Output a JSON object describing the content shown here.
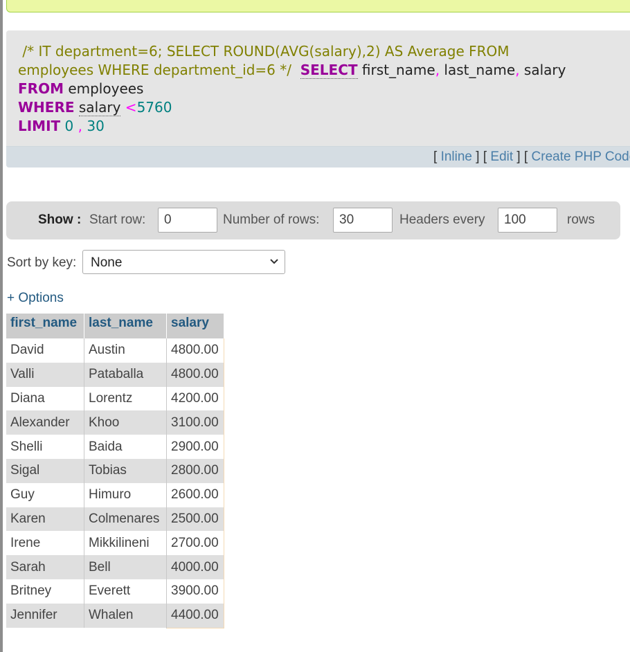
{
  "sql_query": {
    "comment": "/* IT department=6; SELECT ROUND(AVG(salary),2) AS Average FROM",
    "comment_line2": "employees WHERE department_id=6 */",
    "select_kw": "SELECT",
    "col1": "first_name",
    "col2": "last_name",
    "col3": "salary",
    "comma": ",",
    "from_kw": "FROM",
    "table": "employees",
    "where_kw": "WHERE",
    "where_col": "salary",
    "where_op": "<",
    "where_val": "5760",
    "limit_kw": "LIMIT",
    "limit_offset": "0",
    "limit_count": "30"
  },
  "sql_links": {
    "open": "[",
    "close": "]",
    "inline": "Inline",
    "edit": "Edit",
    "create_php": "Create PHP Code"
  },
  "navigation": {
    "show_label": "Show :",
    "start_row_label": "Start row:",
    "start_row_value": "0",
    "num_rows_label": "Number of rows:",
    "num_rows_value": "30",
    "headers_every_label": "Headers every",
    "headers_every_value": "100",
    "rows_label": "rows"
  },
  "sort": {
    "label": "Sort by key:",
    "selected": "None"
  },
  "options_link": "+ Options",
  "table": {
    "columns": [
      "first_name",
      "last_name",
      "salary"
    ],
    "rows": [
      [
        "David",
        "Austin",
        "4800.00"
      ],
      [
        "Valli",
        "Pataballa",
        "4800.00"
      ],
      [
        "Diana",
        "Lorentz",
        "4200.00"
      ],
      [
        "Alexander",
        "Khoo",
        "3100.00"
      ],
      [
        "Shelli",
        "Baida",
        "2900.00"
      ],
      [
        "Sigal",
        "Tobias",
        "2800.00"
      ],
      [
        "Guy",
        "Himuro",
        "2600.00"
      ],
      [
        "Karen",
        "Colmenares",
        "2500.00"
      ],
      [
        "Irene",
        "Mikkilineni",
        "2700.00"
      ],
      [
        "Sarah",
        "Bell",
        "4000.00"
      ],
      [
        "Britney",
        "Everett",
        "3900.00"
      ],
      [
        "Jennifer",
        "Whalen",
        "4400.00"
      ]
    ]
  },
  "colors": {
    "keyword": "#990099",
    "comment": "#808000",
    "number": "#008080",
    "link": "#235a81",
    "notice_bg": "#ebf8a4"
  }
}
